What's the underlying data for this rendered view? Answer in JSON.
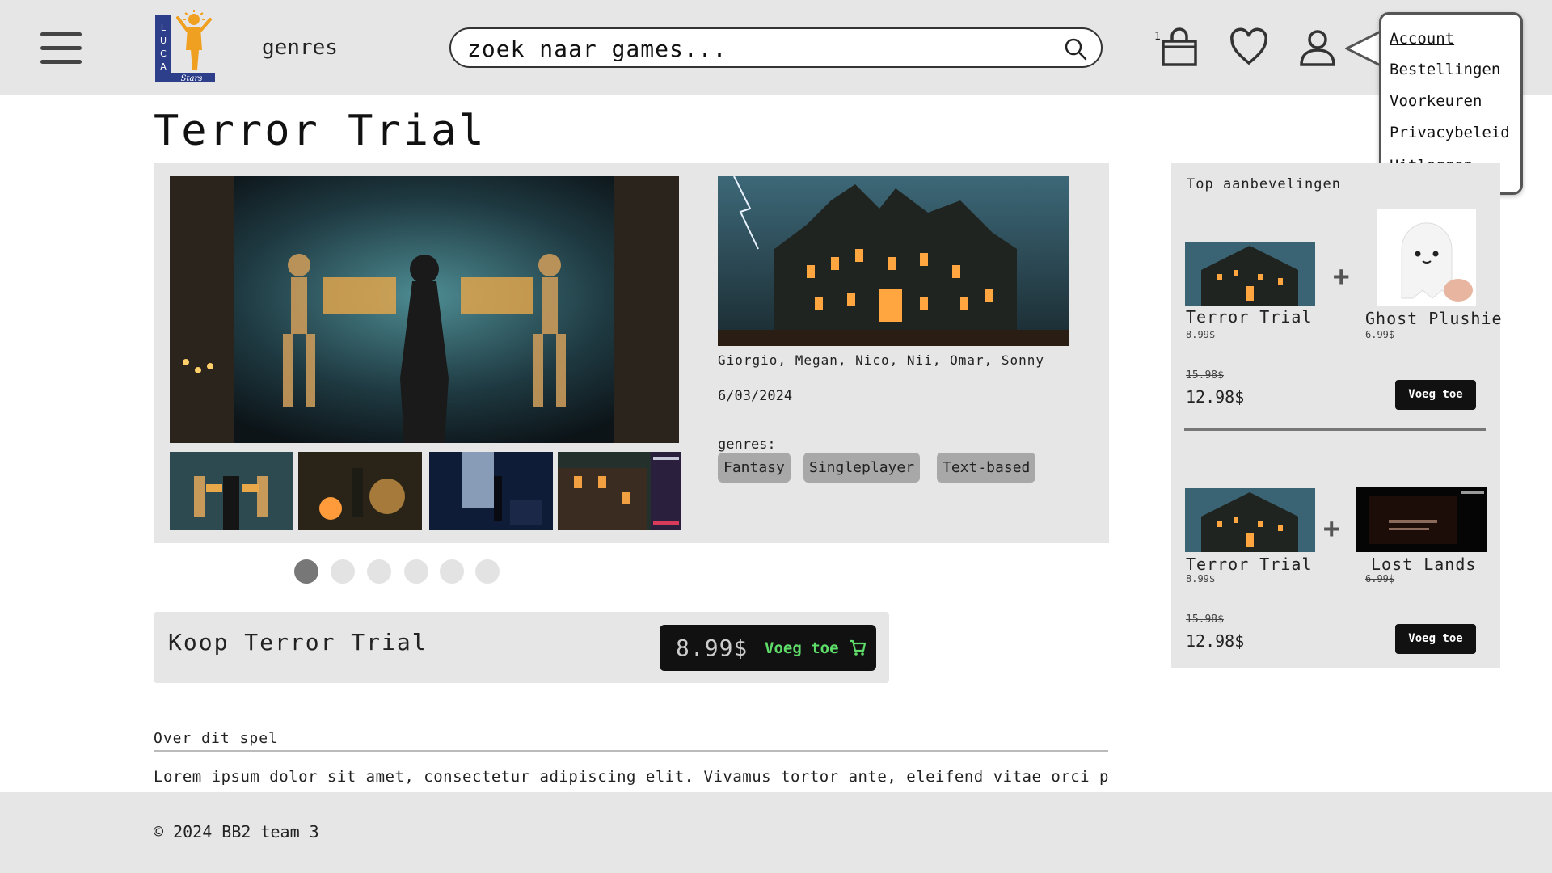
{
  "header": {
    "genres_label": "genres",
    "search_placeholder": "zoek naar games...",
    "cart_count": "1",
    "logo_text": [
      "L",
      "U",
      "C",
      "A",
      "Stars"
    ]
  },
  "account_menu": {
    "items": [
      "Account",
      "Bestellingen",
      "Voorkeuren",
      "Privacybeleid",
      "Uitloggen"
    ]
  },
  "game": {
    "title": "Terror Trial",
    "developers": "Giorgio, Megan, Nico, Nii, Omar, Sonny",
    "release_date": "6/03/2024",
    "genres_label": "genres:",
    "genres": [
      "Fantasy",
      "Singleplayer",
      "Text-based"
    ]
  },
  "carousel": {
    "total": 6,
    "active": 0
  },
  "buy": {
    "title": "Koop Terror Trial",
    "price": "8.99$",
    "button_label": "Voeg toe"
  },
  "about": {
    "title": "Over dit spel",
    "text": "Lorem ipsum dolor sit amet, consectetur adipiscing elit. Vivamus tortor ante, eleifend vitae orci placerat, imperdiet fringilla ligula. Donec sodales vehicula metus, in sollicitudin odio vehicula"
  },
  "recommendations": {
    "title": "Top aanbevelingen",
    "bundles": [
      {
        "item1": {
          "name": "Terror Trial",
          "price": "8.99$"
        },
        "item2": {
          "name": "Ghost Plushie",
          "price": "6.99$"
        },
        "old_total": "15.98$",
        "new_total": "12.98$",
        "button_label": "Voeg toe"
      },
      {
        "item1": {
          "name": "Terror Trial",
          "price": "8.99$"
        },
        "item2": {
          "name": "Lost Lands",
          "price": "6.99$"
        },
        "old_total": "15.98$",
        "new_total": "12.98$",
        "button_label": "Voeg toe"
      }
    ]
  },
  "footer": {
    "copyright": "© 2024 BB2 team 3"
  }
}
